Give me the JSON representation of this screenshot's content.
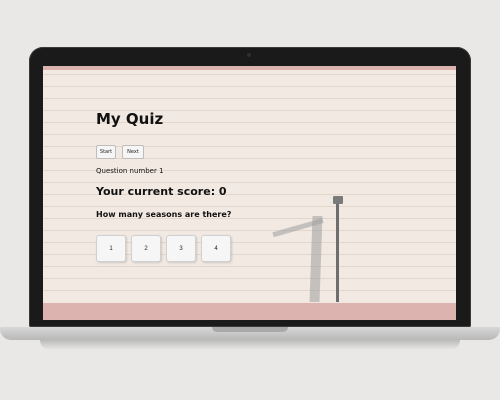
{
  "quiz": {
    "title": "My Quiz",
    "controls": {
      "start_label": "Start",
      "next_label": "Next"
    },
    "question_number": "Question number 1",
    "score_text": "Your current score: 0",
    "question_text": "How many seasons are there?",
    "answers": [
      "1",
      "2",
      "3",
      "4"
    ]
  },
  "colors": {
    "accent_strip": "#dcb3ae",
    "wall": "#f2e9e3",
    "laptop_bezel": "#1a1a1a"
  }
}
